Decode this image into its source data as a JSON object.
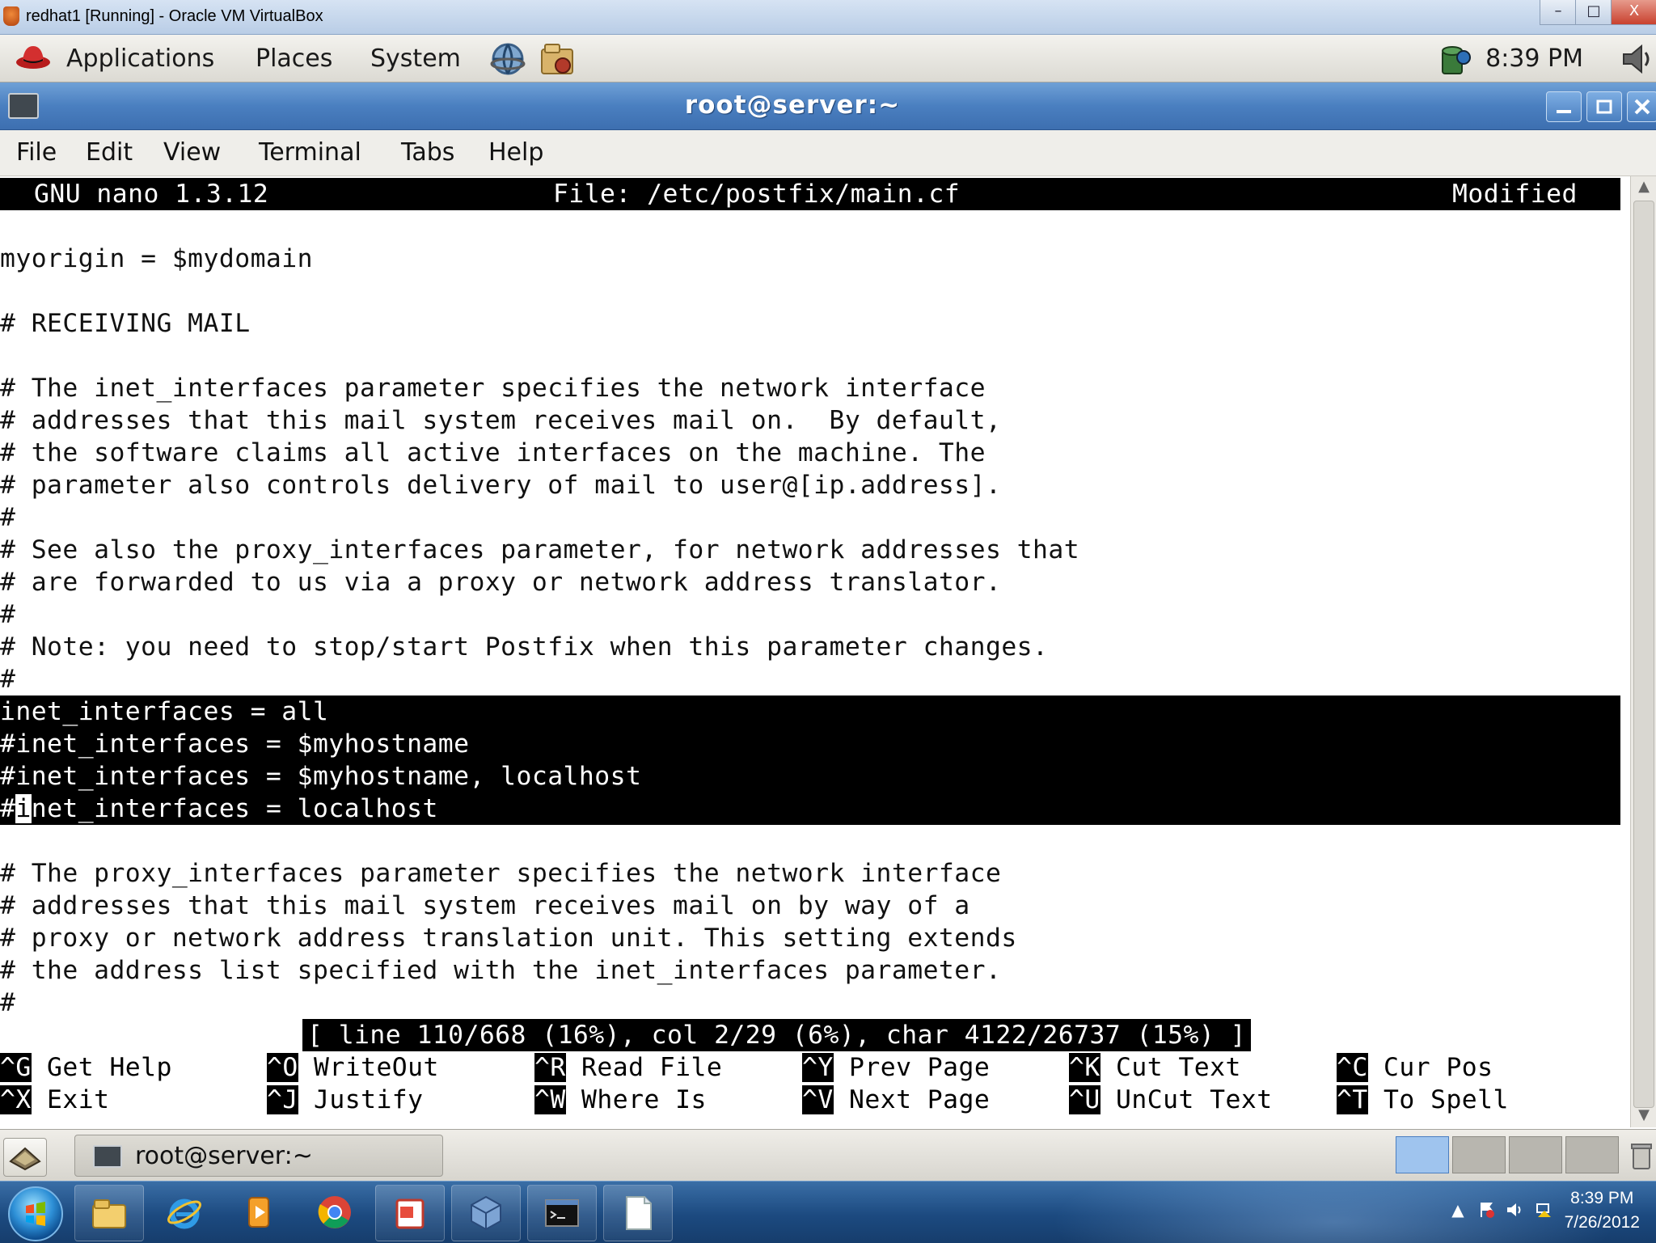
{
  "vbox_window": {
    "title": "redhat1 [Running] - Oracle VM VirtualBox",
    "minimize": "–",
    "maximize": "□",
    "close": "X"
  },
  "gnome_panel": {
    "menus": [
      "Applications",
      "Places",
      "System"
    ],
    "clock": "8:39 PM"
  },
  "terminal_window": {
    "title": "root@server:~",
    "menu": [
      "File",
      "Edit",
      "View",
      "Terminal",
      "Tabs",
      "Help"
    ]
  },
  "nano": {
    "version": "GNU nano 1.3.12",
    "file": "File: /etc/postfix/main.cf",
    "state": "Modified",
    "lines": [
      "",
      "myorigin = $mydomain",
      "",
      "# RECEIVING MAIL",
      "",
      "# The inet_interfaces parameter specifies the network interface",
      "# addresses that this mail system receives mail on.  By default,",
      "# the software claims all active interfaces on the machine. The",
      "# parameter also controls delivery of mail to user@[ip.address].",
      "#",
      "# See also the proxy_interfaces parameter, for network addresses that",
      "# are forwarded to us via a proxy or network address translator.",
      "#",
      "# Note: you need to stop/start Postfix when this parameter changes.",
      "#"
    ],
    "selected_lines": [
      "inet_interfaces = all",
      "#inet_interfaces = $myhostname",
      "#inet_interfaces = $myhostname, localhost"
    ],
    "cursor_line_prefix": "#",
    "cursor_char": "i",
    "cursor_line_rest": "net_interfaces = localhost",
    "lines_after": [
      "",
      "# The proxy_interfaces parameter specifies the network interface",
      "# addresses that this mail system receives mail on by way of a",
      "# proxy or network address translation unit. This setting extends",
      "# the address list specified with the inet_interfaces parameter.",
      "#"
    ],
    "status": "[ line 110/668 (16%), col 2/29 (6%), char 4122/26737 (15%) ]",
    "shortcuts": [
      {
        "key": "^G",
        "label": " Get Help"
      },
      {
        "key": "^O",
        "label": " WriteOut"
      },
      {
        "key": "^R",
        "label": " Read File"
      },
      {
        "key": "^Y",
        "label": " Prev Page"
      },
      {
        "key": "^K",
        "label": " Cut Text"
      },
      {
        "key": "^C",
        "label": " Cur Pos"
      },
      {
        "key": "^X",
        "label": " Exit"
      },
      {
        "key": "^J",
        "label": " Justify"
      },
      {
        "key": "^W",
        "label": " Where Is"
      },
      {
        "key": "^V",
        "label": " Next Page"
      },
      {
        "key": "^U",
        "label": " UnCut Text"
      },
      {
        "key": "^T",
        "label": " To Spell"
      }
    ]
  },
  "gnome_bottom": {
    "task_label": "root@server:~"
  },
  "windows_taskbar": {
    "clock_time": "8:39 PM",
    "clock_date": "7/26/2012",
    "tray_arrow": "▲"
  }
}
